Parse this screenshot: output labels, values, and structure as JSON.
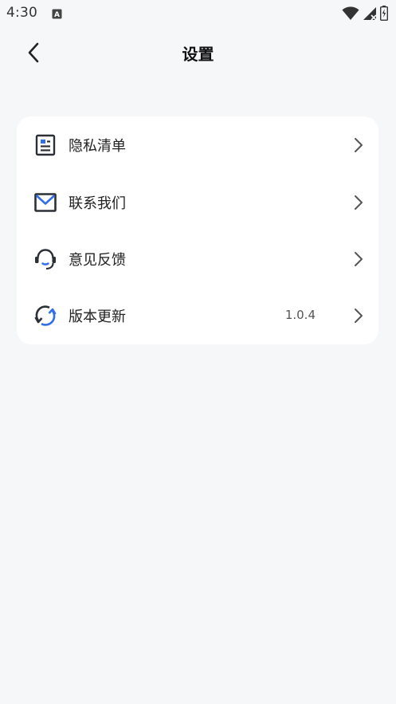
{
  "status_bar": {
    "time": "4:30",
    "notification_icon": "a-text-icon",
    "wifi_icon": "wifi-icon",
    "signal_icon": "signal-icon",
    "battery_icon": "battery-charging-icon"
  },
  "nav": {
    "back_icon": "chevron-left-icon",
    "title": "设置"
  },
  "settings": {
    "items": [
      {
        "label": "隐私清单",
        "icon": "document-list-icon",
        "value": ""
      },
      {
        "label": "联系我们",
        "icon": "mail-icon",
        "value": ""
      },
      {
        "label": "意见反馈",
        "icon": "headset-icon",
        "value": ""
      },
      {
        "label": "版本更新",
        "icon": "refresh-icon",
        "value": "1.0.4"
      }
    ]
  },
  "colors": {
    "background": "#f6f7f9",
    "card": "#ffffff",
    "accent_blue": "#2f6fe8",
    "icon_dark": "#2b2f36"
  }
}
